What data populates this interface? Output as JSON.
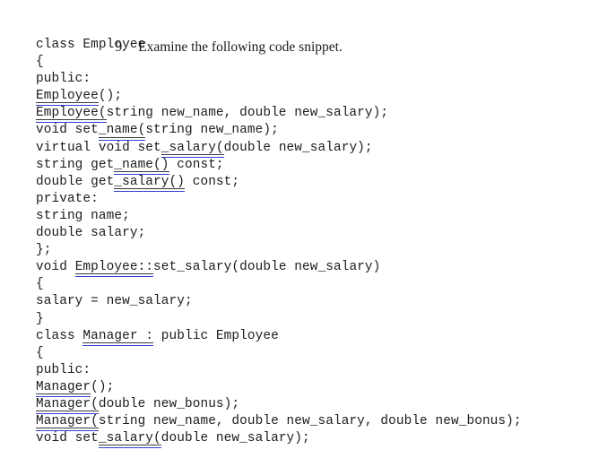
{
  "document": {
    "question": {
      "number": "9.",
      "text": "Examine the following code snippet."
    },
    "code_lines": [
      {
        "id": "l1",
        "text": "class Employee"
      },
      {
        "id": "l2",
        "text": "{"
      },
      {
        "id": "l3",
        "text": "public:"
      },
      {
        "id": "l4",
        "pre": "",
        "marked": "Employee",
        "post": "();"
      },
      {
        "id": "l5",
        "pre": "",
        "marked": "Employee(",
        "post": "string new_name, double new_salary);"
      },
      {
        "id": "l6",
        "pre": "void set",
        "marked": "_name(",
        "post": "string new_name);"
      },
      {
        "id": "l7",
        "pre": "virtual void set",
        "marked": "_salary(",
        "post": "double new_salary);"
      },
      {
        "id": "l8",
        "pre": "string get",
        "marked": "_name()",
        "post": " const;"
      },
      {
        "id": "l9",
        "pre": "double get",
        "marked": "_salary()",
        "post": " const;"
      },
      {
        "id": "l10",
        "text": "private:"
      },
      {
        "id": "l11",
        "text": "string name;"
      },
      {
        "id": "l12",
        "text": "double salary;"
      },
      {
        "id": "l13",
        "text": "};"
      },
      {
        "id": "l14",
        "pre": "void ",
        "marked": "Employee::",
        "post": "set_salary(double new_salary)"
      },
      {
        "id": "l15",
        "text": "{"
      },
      {
        "id": "l16",
        "text": "salary = new_salary;"
      },
      {
        "id": "l17",
        "text": "}"
      },
      {
        "id": "l18",
        "pre": "class ",
        "marked": "Manager :",
        "post": " public Employee"
      },
      {
        "id": "l19",
        "text": "{"
      },
      {
        "id": "l20",
        "text": "public:"
      },
      {
        "id": "l21",
        "pre": "",
        "marked": "Manager",
        "post": "();"
      },
      {
        "id": "l22",
        "pre": "",
        "marked": "Manager(",
        "post": "double new_bonus);"
      },
      {
        "id": "l23",
        "pre": "",
        "marked": "Manager(",
        "post": "string new_name, double new_salary, double new_bonus);"
      },
      {
        "id": "l24",
        "pre": "void set",
        "marked": "_salary(",
        "post": "double new_salary);"
      }
    ],
    "colors": {
      "text": "#1c1c1c",
      "underline_blue": "#2f3fd0",
      "underline_dark": "#39393f",
      "background": "#ffffff"
    }
  }
}
